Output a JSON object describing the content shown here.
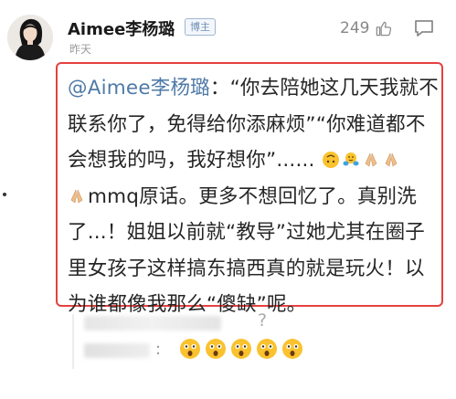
{
  "post": {
    "username": "Aimee李杨璐",
    "badge": "博主",
    "time": "昨天",
    "like_count": "249"
  },
  "icons": {
    "like": "thumbs-up-icon",
    "comment": "comment-bubble-icon"
  },
  "comment": {
    "mention": "@Aimee李杨璐",
    "text": "：“你去陪她这几天我就不联系你了，免得给你添麻烦”“你难道都不会想我的吗，我好想你”......",
    "emojis_inline": [
      "upside-down-face",
      "hug",
      "pray",
      "pray",
      "pray"
    ],
    "text2": "mmq原话。更多不想回忆了。真别洗了...！姐姐以前就“教导”过她尤其在圈子里女孩子这样搞东搞西真的就是玩火！以为谁都像我那么“傻缺”呢。"
  },
  "cropped_reply": {
    "question_mark": "?",
    "colon": ":",
    "shock_emoji_count": 5
  },
  "colors": {
    "highlight_border": "#e5413f",
    "mention": "#4f7aa8",
    "badge": "#6d8fb3"
  }
}
